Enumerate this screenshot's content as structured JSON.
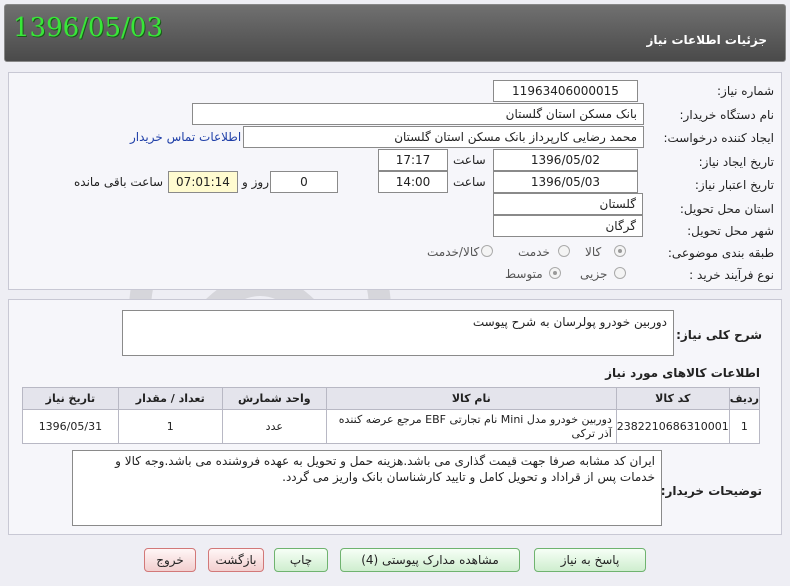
{
  "header": {
    "title": "جزئیات اطلاعات نیاز",
    "date": "1396/05/03"
  },
  "form": {
    "need_number_label": "شماره نیاز:",
    "need_number": "11963406000015",
    "buyer_org_label": "نام دستگاه خریدار:",
    "buyer_org": "بانک مسکن استان گلستان",
    "requester_label": "ایجاد کننده درخواست:",
    "requester": "محمد  رضایی کارپرداز بانک مسکن استان گلستان",
    "contact_link": "اطلاعات تماس خریدار",
    "created_label": "تاریخ ایجاد نیاز:",
    "created_date": "1396/05/02",
    "created_time_label": "ساعت",
    "created_time": "17:17",
    "validity_label": "تاریخ اعتبار نیاز:",
    "validity_date": "1396/05/03",
    "validity_time_label": "ساعت",
    "validity_time": "14:00",
    "days": "0",
    "days_label": "روز و",
    "remaining": "07:01:14",
    "remaining_label": "ساعت باقی مانده",
    "province_label": "استان محل تحویل:",
    "province": "گلستان",
    "city_label": "شهر محل تحویل:",
    "city": "گرگان",
    "category_label": "طبقه بندی موضوعی:",
    "category_options": [
      "کالا",
      "خدمت",
      "کالا/خدمت"
    ],
    "category_selected": "کالا",
    "process_label": "نوع فرآیند خرید :",
    "process_options": [
      "جزیی",
      "متوسط"
    ],
    "process_selected": "متوسط"
  },
  "summary": {
    "label": "شرح کلی نیاز:",
    "text": "دوربین خودرو پولرسان به شرح پیوست"
  },
  "items": {
    "title": "اطلاعات کالاهای مورد نیاز",
    "headers": [
      "ردیف",
      "کد کالا",
      "نام کالا",
      "واحد شمارش",
      "تعداد / مقدار",
      "تاریخ نیاز"
    ],
    "rows": [
      [
        "1",
        "2382210686310001",
        "دوربین خودرو مدل Mini نام تجارتی EBF مرجع عرضه کننده آذر ترکی",
        "عدد",
        "1",
        "1396/05/31"
      ]
    ]
  },
  "notes": {
    "label": "توضیحات خریدار:",
    "text": "ایران کد مشابه صرفا جهت قیمت گذاری می باشد.هزینه حمل و تحویل به عهده فروشنده می باشد.وجه کالا و خدمات پس از قراداد و تحویل کامل و تایید کارشناسان بانک واریز می گردد."
  },
  "buttons": {
    "reply": "پاسخ به نیاز",
    "attachments": "مشاهده مدارک پیوستی (4)",
    "print": "چاپ",
    "back": "بازگشت",
    "exit": "خروج"
  },
  "colors": {
    "date_green": "#39e639",
    "header_gray": "#5a5a5a",
    "link_blue": "#1f3fa8"
  }
}
